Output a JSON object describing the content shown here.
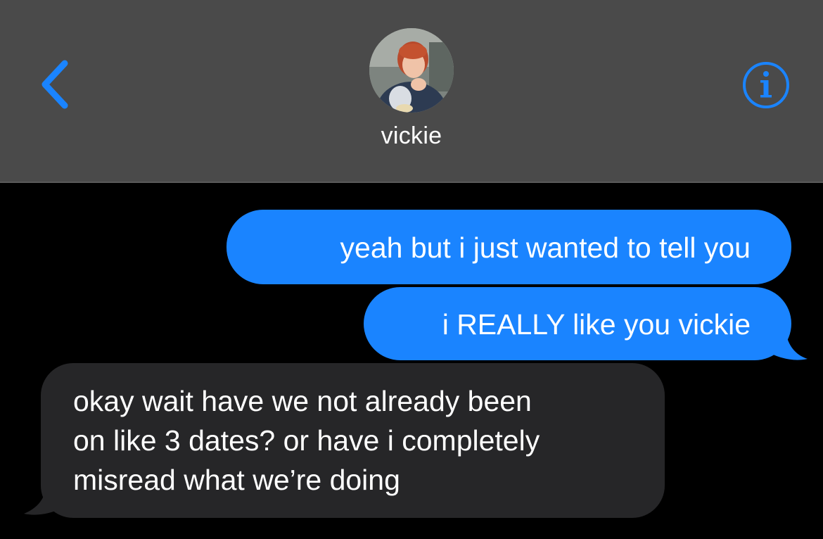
{
  "header": {
    "contact_name": "vickie",
    "back_icon": "chevron-left-icon",
    "info_icon": "info-icon",
    "accent_color": "#1a84ff",
    "background_color": "#4a4a4a"
  },
  "messages": [
    {
      "direction": "outgoing",
      "lines": [
        "yeah but i just wanted to tell you"
      ]
    },
    {
      "direction": "outgoing",
      "lines": [
        "i REALLY like you vickie"
      ]
    },
    {
      "direction": "incoming",
      "lines": [
        "okay wait have we not already been",
        "on like 3 dates? or have i completely",
        "misread what we’re doing"
      ]
    }
  ],
  "colors": {
    "outgoing_bubble": "#1a84ff",
    "incoming_bubble": "#262628",
    "screen_background": "#000000"
  }
}
